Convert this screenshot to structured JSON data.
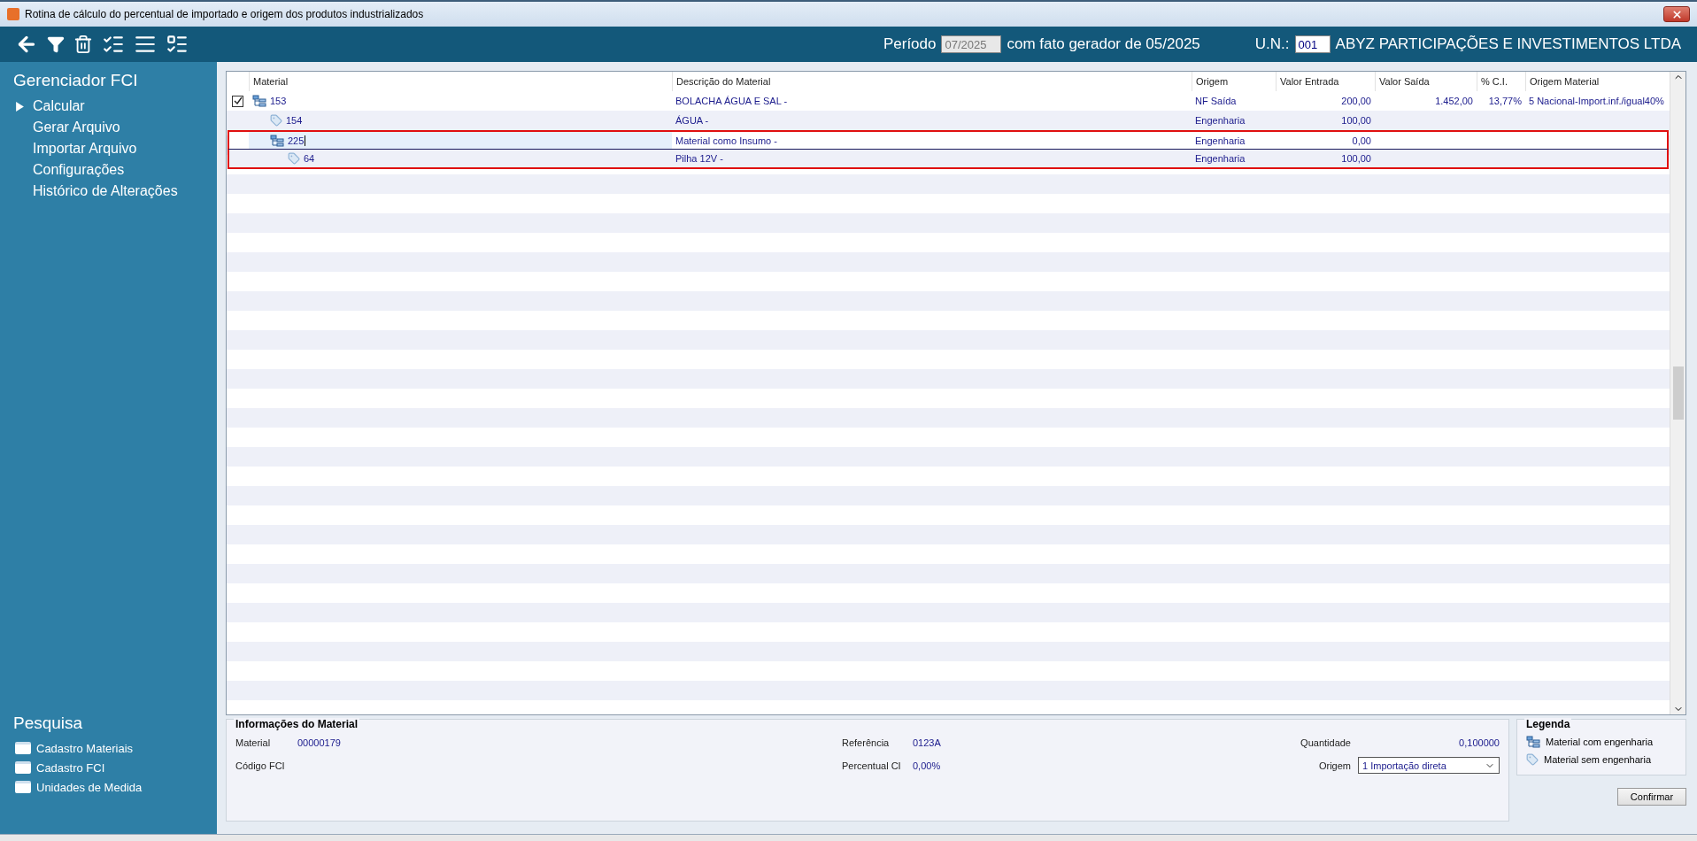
{
  "window": {
    "title": "Rotina de cálculo do percentual de importado e origem dos produtos industrializados"
  },
  "header": {
    "period_label": "Período",
    "period_value": "07/2025",
    "fato_gerador": "com fato gerador de 05/2025",
    "un_label": "U.N.:",
    "un_value": "001",
    "company": "ABYZ PARTICIPAÇÕES E INVESTIMENTOS LTDA"
  },
  "sidebar": {
    "title": "Gerenciador FCI",
    "items": [
      {
        "label": "Calcular",
        "selected": true
      },
      {
        "label": "Gerar Arquivo",
        "selected": false
      },
      {
        "label": "Importar Arquivo",
        "selected": false
      },
      {
        "label": "Configurações",
        "selected": false
      },
      {
        "label": "Histórico de Alterações",
        "selected": false
      }
    ],
    "search_title": "Pesquisa",
    "search_items": [
      "Cadastro Materiais",
      "Cadastro FCI",
      "Unidades de Medida"
    ]
  },
  "table": {
    "columns": [
      "Material",
      "Descrição do Material",
      "Origem",
      "Valor Entrada",
      "Valor Saída",
      "% C.I.",
      "Origem Material"
    ],
    "rows": [
      {
        "kind": "engineering",
        "checked": true,
        "highlighted": false,
        "editing": false,
        "cells": [
          "153",
          "BOLACHA ÁGUA E SAL -",
          "NF Saída",
          "200,00",
          "1.452,00",
          "13,77%",
          "5 Nacional-Import.inf./igual40%"
        ],
        "children": [
          {
            "kind": "tag",
            "highlighted": false,
            "editing": false,
            "cells": [
              "154",
              "ÁGUA -",
              "Engenharia",
              "100,00"
            ]
          },
          {
            "kind": "engineering",
            "highlighted": true,
            "editing": true,
            "cells": [
              "225",
              "Material como Insumo -",
              "Engenharia",
              "0,00"
            ],
            "children": [
              {
                "kind": "tag",
                "highlighted": true,
                "editing": false,
                "cells": [
                  "64",
                  "Pilha 12V -",
                  "Engenharia",
                  "100,00"
                ]
              }
            ]
          }
        ]
      }
    ]
  },
  "info": {
    "title": "Informações do Material",
    "material_label": "Material",
    "material_value": "00000179",
    "codigo_label": "Código FCI",
    "referencia_label": "Referência",
    "referencia_value": "0123A",
    "percentual_label": "Percentual CI",
    "percentual_value": "0,00%",
    "quantidade_label": "Quantidade",
    "quantidade_value": "0,100000",
    "origem_label": "Origem",
    "origem_value": "1 Importação direta"
  },
  "legend": {
    "title": "Legenda",
    "items": [
      {
        "kind": "engineering",
        "label": "Material com engenharia"
      },
      {
        "kind": "tag",
        "label": "Material sem engenharia"
      }
    ]
  },
  "confirm_button": "Confirmar"
}
